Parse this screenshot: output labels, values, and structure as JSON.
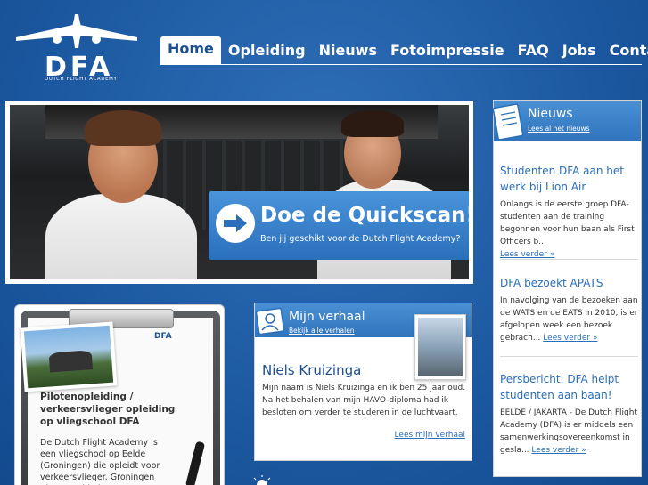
{
  "logo": {
    "letters": "DFA",
    "subtitle": "DUTCH FLIGHT ACADEMY"
  },
  "nav": {
    "items": [
      "Home",
      "Opleiding",
      "Nieuws",
      "Fotoimpressie",
      "FAQ",
      "Jobs",
      "Contact"
    ],
    "active": "Home"
  },
  "hero": {
    "cta_title": "Doe de Quickscan!",
    "cta_subtitle": "Ben jij geschikt voor de Dutch Flight Academy?"
  },
  "clipboard": {
    "heading": "Pilotenopleiding / verkeersvlieger opleiding op vliegschool DFA",
    "text": "De Dutch Flight Academy is een vliegschool op Eelde (Groningen) die opleidt voor verkeersvlieger. Groningen Airport Eelde is een"
  },
  "story": {
    "title": "Mijn verhaal",
    "link": "Bekijk alle verhalen",
    "name": "Niels Kruizinga",
    "text": "Mijn naam is Niels Kruizinga en ik ben 25 jaar oud. Na het behalen van mijn HAVO-diploma had ik besloten om verder te studeren in de luchtvaart.",
    "more": "Lees mijn verhaal"
  },
  "news": {
    "title": "Nieuws",
    "all_link": "Lees al het nieuws",
    "more_label": "Lees verder »",
    "items": [
      {
        "title": "Studenten DFA aan het werk bij Lion Air",
        "text": "Onlangs is de eerste groep DFA-studenten aan de training begonnen voor hun baan als First Officers b..."
      },
      {
        "title": "DFA bezoekt APATS",
        "text": "In navolging van de bezoeken aan de WATS en de EATS in 2010, is er afgelopen week een bezoek gebrach..."
      },
      {
        "title": "Persbericht: DFA helpt studenten aan baan!",
        "text": "EELDE / JAKARTA - De Dutch Flight Academy (DFA) is er middels een samenwerkingsovereenkomst in gesla..."
      }
    ]
  },
  "colors": {
    "background": "#1d5aa2",
    "panel_header": "#3a82c9",
    "link": "#2a6fba",
    "heading_blue": "#1d4f8f"
  }
}
